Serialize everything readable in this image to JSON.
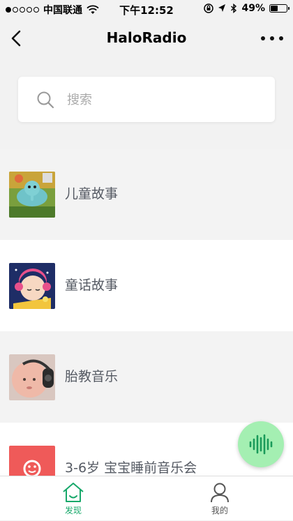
{
  "status_bar": {
    "carrier": "中国联通",
    "time": "下午12:52",
    "battery_percent": "49%",
    "battery_level": 0.49,
    "signal_dots_filled": 1
  },
  "navbar": {
    "title": "HaloRadio",
    "back_icon": "chevron-left-icon",
    "more_icon": "more-horizontal-icon"
  },
  "search": {
    "placeholder": "搜索",
    "value": ""
  },
  "list": {
    "items": [
      {
        "label": "儿童故事",
        "thumb": "elephant-cartoon"
      },
      {
        "label": "童话故事",
        "thumb": "sleeping-baby-cartoon"
      },
      {
        "label": "胎教音乐",
        "thumb": "baby-headphones-photo"
      },
      {
        "label": "3-6岁 宝宝睡前音乐会",
        "thumb": "red-smile-logo"
      }
    ]
  },
  "voice_button": {
    "icon": "sound-wave-icon",
    "color": "#a4efb2"
  },
  "tabbar": {
    "tabs": [
      {
        "label": "发现",
        "icon": "house-icon",
        "active": true,
        "color": "#17a86a"
      },
      {
        "label": "我的",
        "icon": "person-icon",
        "active": false,
        "color": "#555555"
      }
    ]
  }
}
